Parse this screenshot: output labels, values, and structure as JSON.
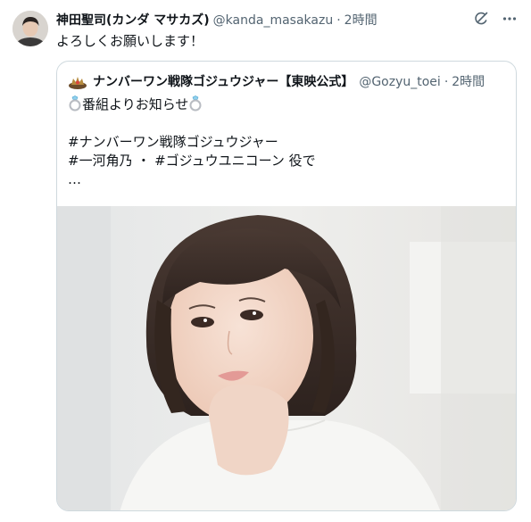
{
  "tweet": {
    "author": {
      "display_name": "神田聖司(カンダ マサカズ)",
      "handle": "@kanda_masakazu",
      "time": "2時間"
    },
    "text": "よろしくお願いします！",
    "separator": "·"
  },
  "quote": {
    "author": {
      "display_name": "ナンバーワン戦隊ゴジュウジャー【東映公式】",
      "handle": "@Gozyu_toei",
      "time": "2時間"
    },
    "lines": {
      "line1": "番組よりお知らせ",
      "line2": "#ナンバーワン戦隊ゴジュウジャー",
      "line3": "#一河角乃 ・ #ゴジュウユニコーン 役で",
      "line4": "…"
    },
    "separator": "·"
  },
  "icons": {
    "grok": "grok-icon",
    "more": "more-icon",
    "ring": "ring-icon"
  },
  "colors": {
    "text": "#0f1419",
    "secondary": "#536471",
    "border": "#cfd9de"
  }
}
